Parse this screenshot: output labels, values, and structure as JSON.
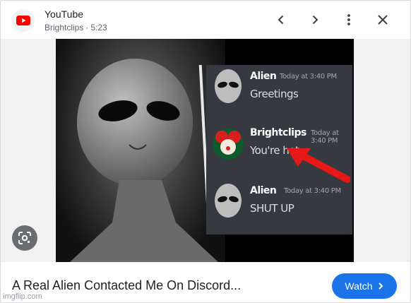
{
  "header": {
    "source_name": "YouTube",
    "channel": "Brightclips",
    "separator": "·",
    "duration": "5:23",
    "icons": {
      "favicon": "youtube-logo-icon",
      "prev": "chevron-left-icon",
      "next": "chevron-right-icon",
      "more": "more-vert-icon",
      "close": "close-icon"
    }
  },
  "thumbnail": {
    "messages": [
      {
        "author": "Alien",
        "timestamp": "Today at 3:40 PM",
        "text": "Greetings"
      },
      {
        "author": "Brightclips",
        "timestamp": "Today at 3:40 PM",
        "text": "You're hot"
      },
      {
        "author": "Alien",
        "timestamp": "Today at 3:40 PM",
        "text": "SHUT UP"
      }
    ],
    "lens_icon": "google-lens-icon"
  },
  "footer": {
    "title": "A Real Alien Contacted Me On Discord...",
    "watch_label": "Watch",
    "watch_icon": "chevron-right-icon"
  },
  "watermark": "imgflip.com",
  "colors": {
    "accent": "#1a73e8",
    "youtube_red": "#ff0000",
    "discord_bg": "#36393f",
    "arrow_red": "#e81818"
  }
}
